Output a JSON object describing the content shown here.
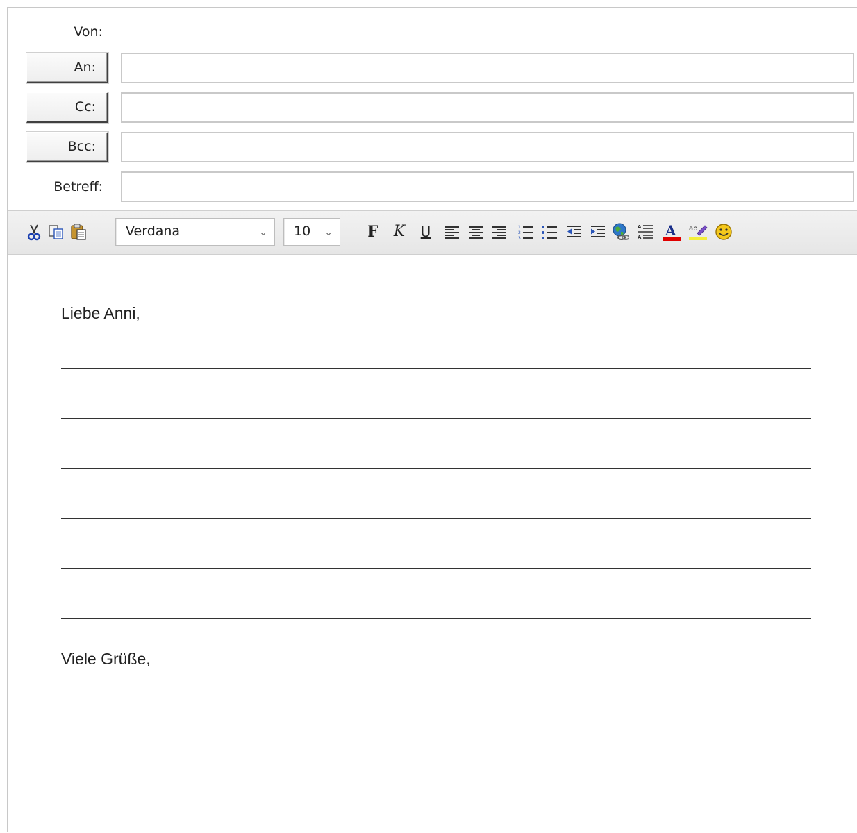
{
  "header": {
    "from_label": "Von:",
    "to_button": "An:",
    "cc_button": "Cc:",
    "bcc_button": "Bcc:",
    "subject_label": "Betreff:",
    "to_value": "",
    "cc_value": "",
    "bcc_value": "",
    "subject_value": ""
  },
  "toolbar": {
    "font_family": "Verdana",
    "font_size": "10",
    "dropdown_caret": "⌄",
    "bold_label": "F",
    "italic_label": "K",
    "underline_label": "U",
    "icons": [
      "scissors-icon",
      "copy-icon",
      "paste-icon",
      "align-left-icon",
      "align-center-icon",
      "align-right-icon",
      "numbered-list-icon",
      "bullet-list-icon",
      "outdent-icon",
      "indent-icon",
      "insert-link-icon",
      "line-spacing-icon",
      "font-color-icon",
      "highlight-icon",
      "emoji-icon"
    ],
    "font_color": "#e00000",
    "highlight_color": "#f4ee3c"
  },
  "body": {
    "greeting": "Liebe Anni,",
    "closing": "Viele Grüße,",
    "blank_line_count": 6
  }
}
